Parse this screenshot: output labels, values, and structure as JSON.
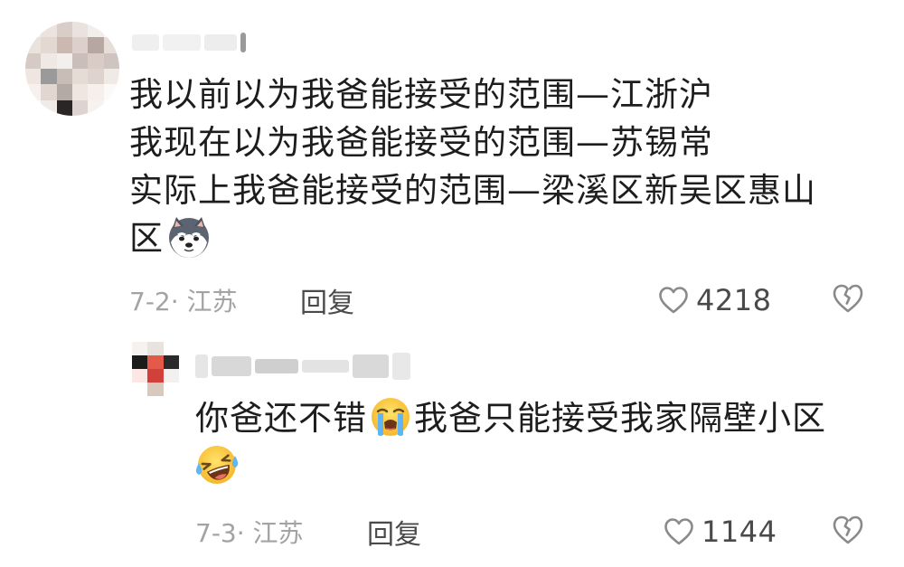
{
  "comments": [
    {
      "text_lines": [
        "我以前以为我爸能接受的范围—江浙沪",
        "我现在以为我爸能接受的范围—苏锡常",
        "实际上我爸能接受的范围—梁溪区新吴区惠山",
        "区"
      ],
      "trailing_emoji": "husky-dog-emoji",
      "date_location": "7-2· 江苏",
      "reply_label": "回复",
      "like_count": "4218"
    },
    {
      "text_lines": [
        "你爸还不错",
        "我爸只能接受我家隔壁小区"
      ],
      "inline_emoji": "loudly-crying-emoji",
      "trailing_emoji": "laughing-tears-emoji",
      "date_location": "7-3· 江苏",
      "reply_label": "回复",
      "like_count": "1144"
    }
  ],
  "icons": {
    "like": "heart-outline-icon",
    "dislike": "broken-heart-icon"
  },
  "colors": {
    "text": "#1d1d1d",
    "meta": "#a3a3a3",
    "action": "#4a4a4a",
    "icon": "#8a8a8a"
  }
}
